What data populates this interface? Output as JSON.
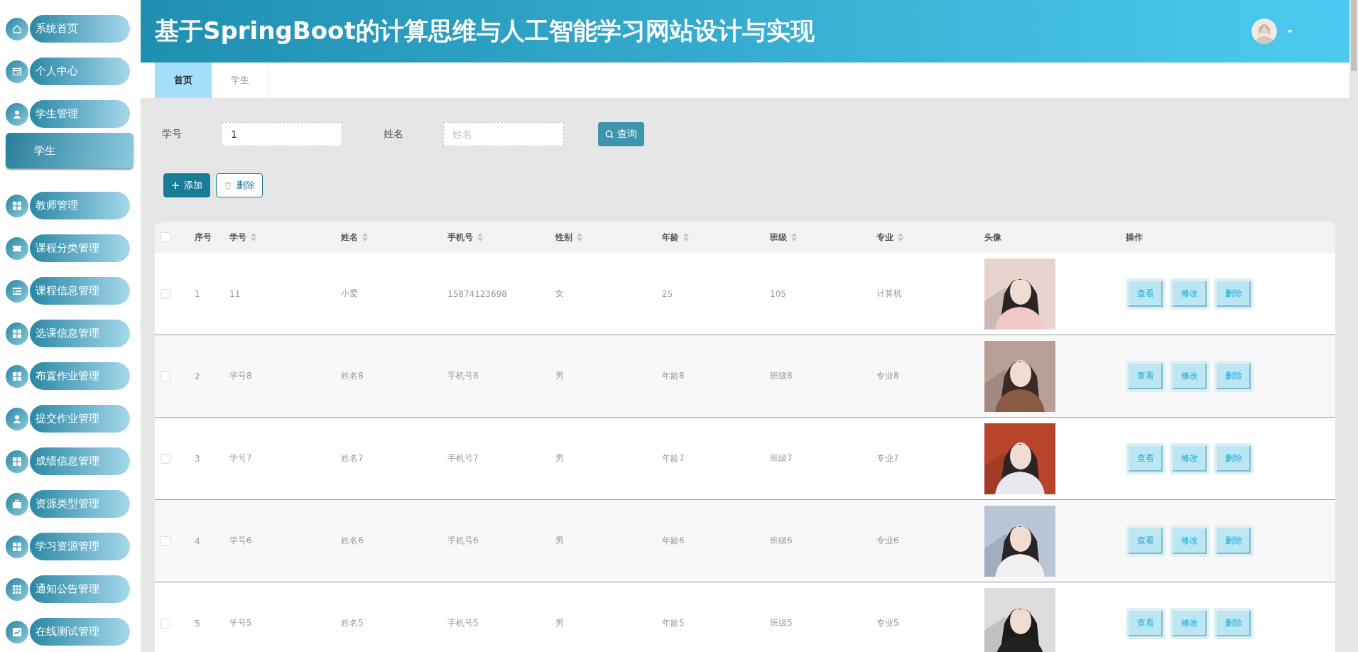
{
  "sidebar": {
    "items": [
      {
        "label": "系统首页"
      },
      {
        "label": "个人中心"
      },
      {
        "label": "学生管理",
        "children": [
          {
            "label": "学生"
          }
        ]
      },
      {
        "label": "教师管理"
      },
      {
        "label": "课程分类管理"
      },
      {
        "label": "课程信息管理"
      },
      {
        "label": "选课信息管理"
      },
      {
        "label": "布置作业管理"
      },
      {
        "label": "提交作业管理"
      },
      {
        "label": "成绩信息管理"
      },
      {
        "label": "资源类型管理"
      },
      {
        "label": "学习资源管理"
      },
      {
        "label": "通知公告管理"
      },
      {
        "label": "在线测试管理"
      }
    ]
  },
  "header": {
    "title": "基于SpringBoot的计算思维与人工智能学习网站设计与实现"
  },
  "tabs": [
    {
      "label": "首页",
      "selected": true
    },
    {
      "label": "学生",
      "selected": false
    }
  ],
  "search": {
    "fields": [
      {
        "label": "学号",
        "value": "1"
      },
      {
        "label": "姓名",
        "placeholder": "姓名"
      }
    ],
    "button": "查询"
  },
  "actions": [
    {
      "kind": "add",
      "label": "添加"
    },
    {
      "kind": "delete",
      "label": "删除"
    }
  ],
  "table": {
    "header_checked": false,
    "columns": [
      {
        "label": "序号",
        "sortable": false
      },
      {
        "label": "学号",
        "sortable": true
      },
      {
        "label": "姓名",
        "sortable": true
      },
      {
        "label": "手机号",
        "sortable": true
      },
      {
        "label": "性别",
        "sortable": true
      },
      {
        "label": "年龄",
        "sortable": true
      },
      {
        "label": "班级",
        "sortable": true
      },
      {
        "label": "专业",
        "sortable": true
      },
      {
        "label": "头像",
        "sortable": false
      },
      {
        "label": "操作",
        "sortable": false
      }
    ],
    "rows": [
      {
        "checked": false,
        "cells": [
          "1",
          "11",
          "小爱",
          "15874123698",
          "女",
          "25",
          "105",
          "计算机"
        ],
        "buttons": [
          "查看",
          "修改",
          "删除"
        ]
      },
      {
        "checked": false,
        "cells": [
          "2",
          "学号8",
          "姓名8",
          "手机号8",
          "男",
          "年龄8",
          "班级8",
          "专业8"
        ],
        "buttons": [
          "查看",
          "修改",
          "删除"
        ]
      },
      {
        "checked": false,
        "cells": [
          "3",
          "学号7",
          "姓名7",
          "手机号7",
          "男",
          "年龄7",
          "班级7",
          "专业7"
        ],
        "buttons": [
          "查看",
          "修改",
          "删除"
        ]
      },
      {
        "checked": false,
        "cells": [
          "4",
          "学号6",
          "姓名6",
          "手机号6",
          "男",
          "年龄6",
          "班级6",
          "专业6"
        ],
        "buttons": [
          "查看",
          "修改",
          "删除"
        ]
      },
      {
        "checked": false,
        "cells": [
          "5",
          "学号5",
          "姓名5",
          "手机号5",
          "男",
          "年龄5",
          "班级5",
          "专业5"
        ],
        "buttons": [
          "查看",
          "修改",
          "删除"
        ]
      }
    ]
  }
}
